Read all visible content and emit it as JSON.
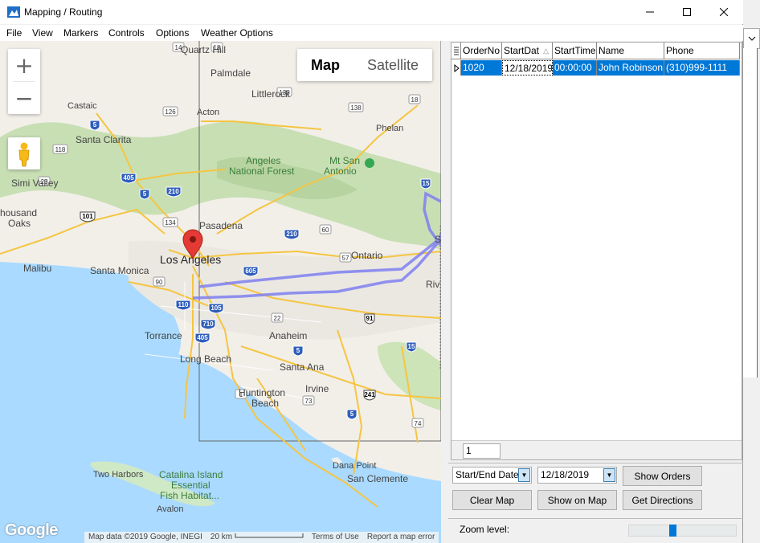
{
  "window": {
    "title": "Mapping / Routing",
    "minimize_icon": "minimize-icon",
    "maximize_icon": "maximize-icon",
    "close_icon": "close-icon"
  },
  "menu": [
    "File",
    "View",
    "Markers",
    "Controls",
    "Options",
    "Weather Options"
  ],
  "map": {
    "type_buttons": {
      "map": "Map",
      "satellite": "Satellite"
    },
    "zoom_in": "+",
    "zoom_out": "−",
    "logo": "Google",
    "attribution": {
      "data": "Map data ©2019 Google, INEGI",
      "scale": "20 km",
      "terms": "Terms of Use",
      "report": "Report a map error"
    },
    "labels": {
      "quartz_hill": "Quartz Hill",
      "palmdale": "Palmdale",
      "littlerock": "Littlerock",
      "castaic": "Castaic",
      "acton": "Acton",
      "phelan": "Phelan",
      "santa_clarita": "Santa Clarita",
      "angeles_nf_1": "Angeles",
      "angeles_nf_2": "National Forest",
      "mt_san_1": "Mt San",
      "mt_san_2": "Antonio",
      "simi_valley": "Simi Valley",
      "thousand_1": "housand",
      "thousand_2": "Oaks",
      "pasadena": "Pasadena",
      "los_angeles": "Los Angeles",
      "ontario": "Ontario",
      "malibu": "Malibu",
      "santa_monica": "Santa Monica",
      "torrance": "Torrance",
      "anaheim": "Anaheim",
      "long_beach": "Long Beach",
      "santa_ana": "Santa Ana",
      "irvine": "Irvine",
      "huntington_1": "Huntington",
      "huntington_2": "Beach",
      "dana_point": "Dana Point",
      "san_clemente": "San Clemente",
      "two_harbors": "Two Harbors",
      "catalina_1": "Catalina Island",
      "catalina_2": "Essential",
      "catalina_3": "Fish Habitat...",
      "avalon": "Avalon",
      "riv": "Riv",
      "s_cut": "S"
    },
    "shields": {
      "i5a": "5",
      "i405a": "405",
      "i5b": "5",
      "i210a": "210",
      "i101": "101",
      "i210b": "210",
      "i605": "605",
      "i110": "110",
      "i105": "105",
      "i710": "710",
      "i405b": "405",
      "i5c": "5",
      "i91": "91",
      "i15a": "15",
      "i15b": "15",
      "i241": "241",
      "i5d": "5",
      "s14": "14",
      "s18": "18",
      "s138": "138",
      "s138b": "138",
      "s73": "73",
      "s126": "126",
      "s23": "23",
      "s118": "118",
      "s134": "134",
      "s57": "57",
      "s1": "1",
      "s74": "74",
      "s60": "60",
      "s90": "90",
      "s22": "22"
    }
  },
  "grid": {
    "columns": [
      "OrderNo",
      "StartDat",
      "StartTime",
      "Name",
      "Phone"
    ],
    "rows": [
      {
        "order": "1020",
        "date": "12/18/2019",
        "time": "00:00:00",
        "name": "John Robinson",
        "phone": "(310)999-1111"
      }
    ],
    "page": "1"
  },
  "controls": {
    "mode_select": "Start/End Date",
    "date_select": "12/18/2019",
    "show_orders": "Show Orders",
    "clear_map": "Clear Map",
    "show_on_map": "Show on Map",
    "get_directions": "Get Directions",
    "zoom_label": "Zoom level:",
    "zoom_value": 0.4
  },
  "colors": {
    "route": "#7f7ff0",
    "selection": "#0078d7",
    "marker": "#e53935"
  }
}
